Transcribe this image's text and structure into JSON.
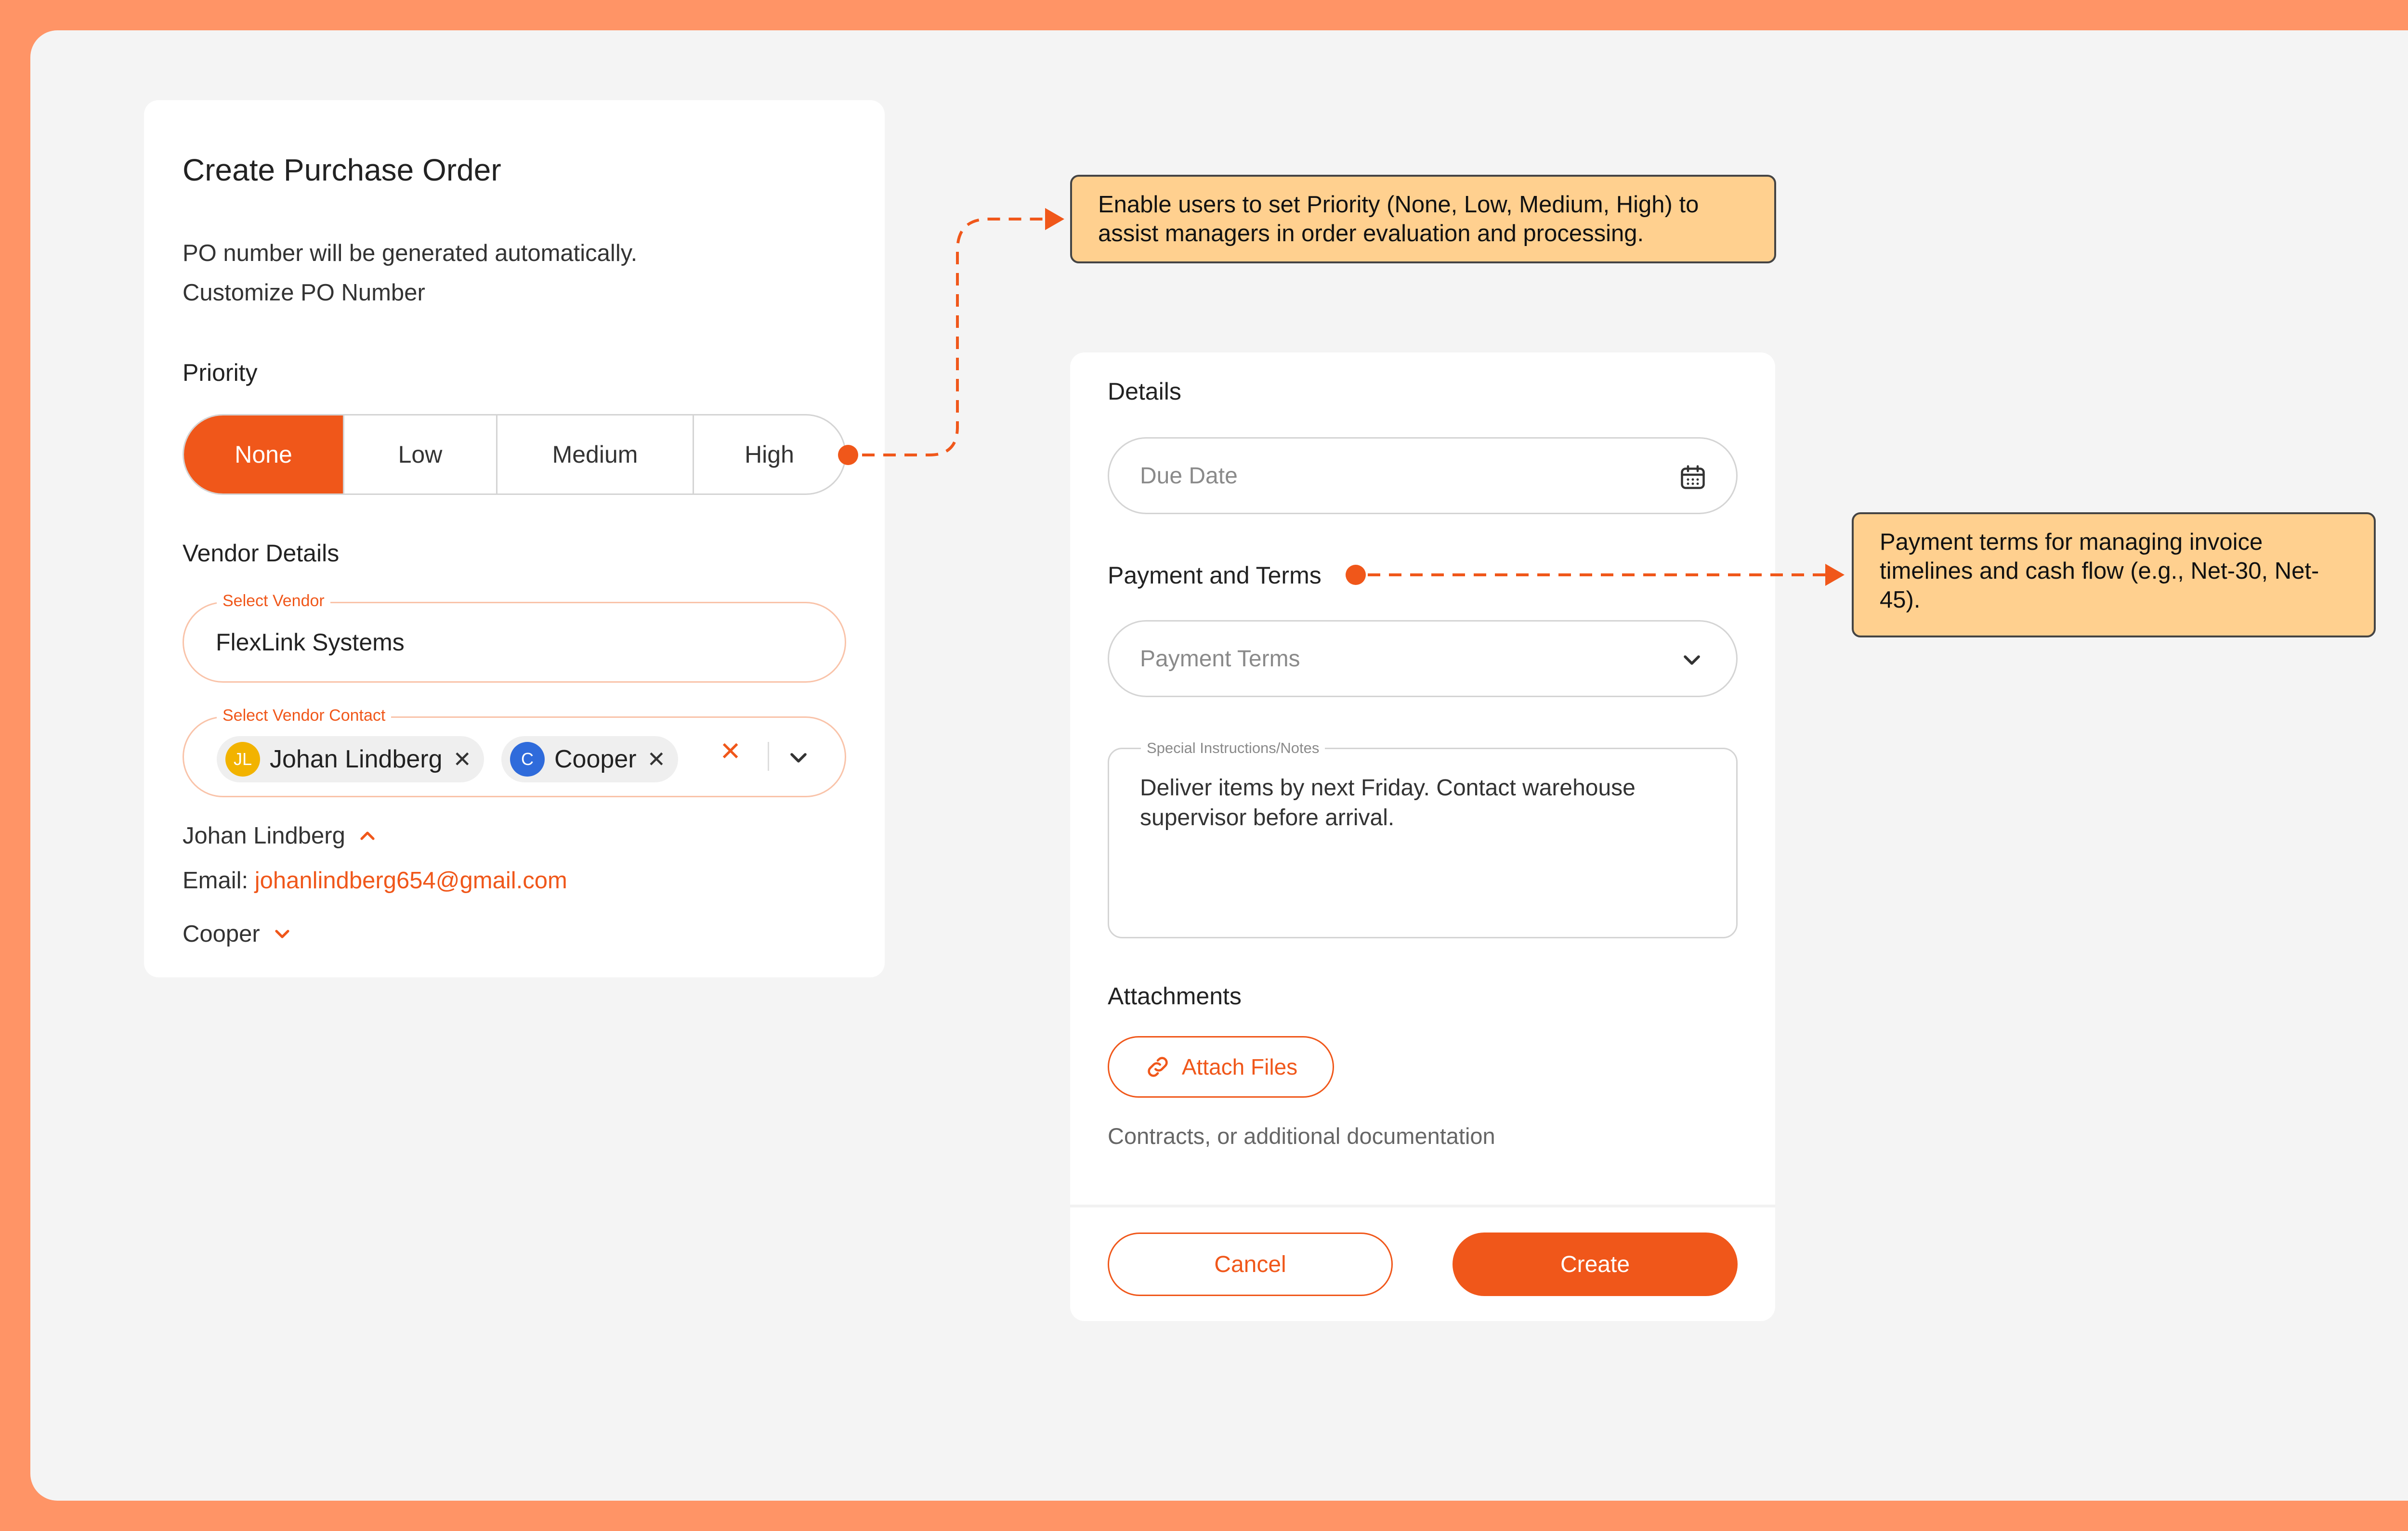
{
  "po_form": {
    "title": "Create Purchase Order",
    "auto_text": "PO number will be generated automatically.",
    "customize_link": "Customize PO Number",
    "priority_label": "Priority",
    "priority_options": [
      "None",
      "Low",
      "Medium",
      "High"
    ],
    "priority_selected": "None",
    "vendor_details_label": "Vendor Details",
    "select_vendor_legend": "Select Vendor",
    "select_vendor_value": "FlexLink Systems",
    "vendor_contact_legend": "Select Vendor Contact",
    "contacts": [
      {
        "initials": "JL",
        "name": "Johan Lindberg",
        "color": "#F2B300"
      },
      {
        "initials": "C",
        "name": "Cooper",
        "color": "#2F6BDB"
      }
    ],
    "contact_expanded_name": "Johan Lindberg",
    "email_label": "Email:",
    "email_value": "johanlindberg654@gmail.com",
    "contact_collapsed_name": "Cooper"
  },
  "details": {
    "heading": "Details",
    "due_date_placeholder": "Due Date",
    "payment_heading": "Payment and Terms",
    "payment_terms_placeholder": "Payment Terms",
    "special_legend": "Special Instructions/Notes",
    "special_text": "Deliver items by next Friday. Contact warehouse supervisor before arrival.",
    "attachments_heading": "Attachments",
    "attach_button": "Attach Files",
    "attach_hint": "Contracts, or additional documentation",
    "cancel_button": "Cancel",
    "create_button": "Create"
  },
  "annotations": {
    "priority_note": "Enable users to set Priority (None, Low, Medium, High) to assist managers in order evaluation and processing.",
    "payment_note": "Payment terms for managing invoice timelines and cash flow (e.g., Net-30, Net-45)."
  },
  "colors": {
    "accent": "#F0571A",
    "frame": "#FF9466",
    "note_bg": "#FFD08F"
  }
}
